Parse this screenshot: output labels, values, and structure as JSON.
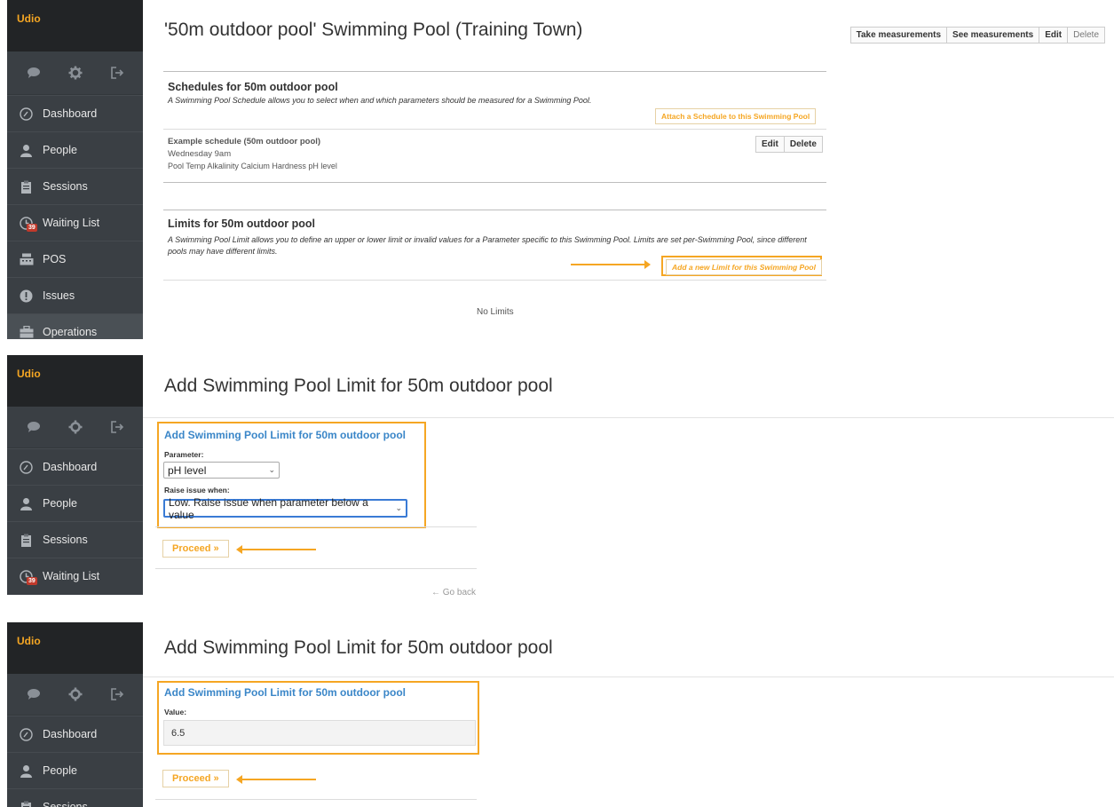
{
  "colors": {
    "accent": "#f5a623",
    "link_blue": "#3a86c8",
    "sidebar_bg": "#3a3f44",
    "badge_red": "#c0392b"
  },
  "sidebar": {
    "brand": "Udio",
    "icons": [
      "chat-icon",
      "gear-icon",
      "logout-icon"
    ],
    "items": [
      {
        "label": "Dashboard",
        "icon": "dashboard-icon"
      },
      {
        "label": "People",
        "icon": "person-icon"
      },
      {
        "label": "Sessions",
        "icon": "clipboard-icon"
      },
      {
        "label": "Waiting List",
        "icon": "clock-icon",
        "badge": "39"
      },
      {
        "label": "POS",
        "icon": "register-icon"
      },
      {
        "label": "Issues",
        "icon": "alert-icon"
      },
      {
        "label": "Operations",
        "icon": "briefcase-icon"
      }
    ]
  },
  "panel1": {
    "title": "'50m outdoor pool' Swimming Pool (Training Town)",
    "actions": [
      "Take measurements",
      "See measurements",
      "Edit",
      "Delete"
    ],
    "schedules": {
      "title": "Schedules for 50m outdoor pool",
      "description": "A Swimming Pool Schedule allows you to select when and which parameters should be measured for a Swimming Pool.",
      "attach_label": "Attach a Schedule to this Swimming Pool",
      "item": {
        "name": "Example schedule (50m outdoor pool)",
        "when": "Wednesday 9am",
        "params": "Pool Temp Alkalinity Calcium Hardness pH level",
        "edit": "Edit",
        "delete": "Delete"
      }
    },
    "limits": {
      "title": "Limits for 50m outdoor pool",
      "description": "A Swimming Pool Limit allows you to define an upper or lower limit or invalid values for a Parameter specific to this Swimming Pool. Limits are set per-Swimming Pool, since different pools may have different limits.",
      "add_label": "Add a new Limit for this Swimming Pool",
      "empty": "No Limits"
    }
  },
  "panel2": {
    "title": "Add Swimming Pool Limit for 50m outdoor pool",
    "form_title": "Add Swimming Pool Limit for 50m outdoor pool",
    "parameter_label": "Parameter:",
    "parameter_value": "pH level",
    "raise_label": "Raise issue when:",
    "raise_value": "Low. Raise issue when parameter below a value",
    "proceed": "Proceed »",
    "go_back": "← Go back"
  },
  "panel3": {
    "title": "Add Swimming Pool Limit for 50m outdoor pool",
    "form_title": "Add Swimming Pool Limit for 50m outdoor pool",
    "value_label": "Value:",
    "value": "6.5",
    "proceed": "Proceed »"
  }
}
